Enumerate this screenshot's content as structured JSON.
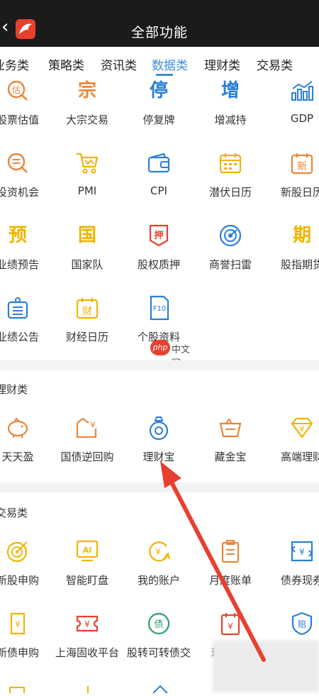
{
  "header": {
    "title": "全部功能",
    "back_icon": "chevron-left-icon",
    "logo_icon": "app-logo-icon"
  },
  "tabs": [
    {
      "label": "业务类",
      "active": false
    },
    {
      "label": "策略类",
      "active": false
    },
    {
      "label": "资讯类",
      "active": false
    },
    {
      "label": "数据类",
      "active": true
    },
    {
      "label": "理财类",
      "active": false
    },
    {
      "label": "交易类",
      "active": false
    }
  ],
  "data_section": {
    "items": [
      {
        "label": "股票估值",
        "icon": "valuation-icon",
        "glyph": "估"
      },
      {
        "label": "大宗交易",
        "icon": "block-trade-icon",
        "glyph": "宗"
      },
      {
        "label": "停复牌",
        "icon": "suspension-icon",
        "glyph": "停"
      },
      {
        "label": "增减持",
        "icon": "holding-change-icon",
        "glyph": "增"
      },
      {
        "label": "GDP",
        "icon": "bar-chart-icon"
      },
      {
        "label": "投资机会",
        "icon": "opportunity-icon"
      },
      {
        "label": "PMI",
        "icon": "cart-icon"
      },
      {
        "label": "CPI",
        "icon": "wallet-icon"
      },
      {
        "label": "潜伏日历",
        "icon": "calendar-icon"
      },
      {
        "label": "新股日历",
        "icon": "new-stock-calendar-icon",
        "glyph": "新"
      },
      {
        "label": "业绩预告",
        "icon": "forecast-icon",
        "glyph": "预"
      },
      {
        "label": "国家队",
        "icon": "national-team-icon",
        "glyph": "国"
      },
      {
        "label": "股权质押",
        "icon": "pledge-icon",
        "glyph": "押"
      },
      {
        "label": "商誉扫雷",
        "icon": "goodwill-radar-icon"
      },
      {
        "label": "股指期货",
        "icon": "futures-icon",
        "glyph": "期"
      },
      {
        "label": "业绩公告",
        "icon": "announcement-icon"
      },
      {
        "label": "财经日历",
        "icon": "finance-calendar-icon",
        "glyph": "财"
      },
      {
        "label": "个股资料",
        "icon": "f10-document-icon",
        "glyph": "F10"
      }
    ]
  },
  "wealth_section": {
    "title": "理财类",
    "items": [
      {
        "label": "天天盈",
        "icon": "piggy-bank-icon"
      },
      {
        "label": "国债逆回购",
        "icon": "bond-repo-icon"
      },
      {
        "label": "理财宝",
        "icon": "money-bag-icon"
      },
      {
        "label": "藏金宝",
        "icon": "gold-basket-icon"
      },
      {
        "label": "高端理财",
        "icon": "diamond-icon",
        "glyph": "¥"
      }
    ]
  },
  "trade_section": {
    "title": "交易类",
    "items": [
      {
        "label": "新股申购",
        "icon": "target-icon"
      },
      {
        "label": "智能盯盘",
        "icon": "ai-monitor-icon",
        "glyph": "AI"
      },
      {
        "label": "我的账户",
        "icon": "account-icon",
        "glyph": "¥"
      },
      {
        "label": "月度账单",
        "icon": "monthly-bill-icon"
      },
      {
        "label": "债券现券",
        "icon": "bond-exchange-icon",
        "glyph": "¥"
      },
      {
        "label": "新债申购",
        "icon": "new-bond-icon",
        "glyph": "¥"
      },
      {
        "label": "上海固收平台",
        "icon": "fixed-income-icon",
        "glyph": "¥"
      },
      {
        "label": "股转可转债交",
        "icon": "convertible-bond-icon",
        "glyph": "债"
      },
      {
        "label": "现",
        "icon": "cash-calendar-icon",
        "glyph": "¥"
      },
      {
        "label": "",
        "icon": "compensation-icon",
        "glyph": "赔"
      }
    ]
  },
  "watermark": {
    "php": "php",
    "cn": "中文网"
  },
  "colors": {
    "accent": "#3d8ede",
    "orange": "#e8863a",
    "red": "#e8402f",
    "gold": "#f0b400",
    "blue": "#2a7fd6"
  }
}
